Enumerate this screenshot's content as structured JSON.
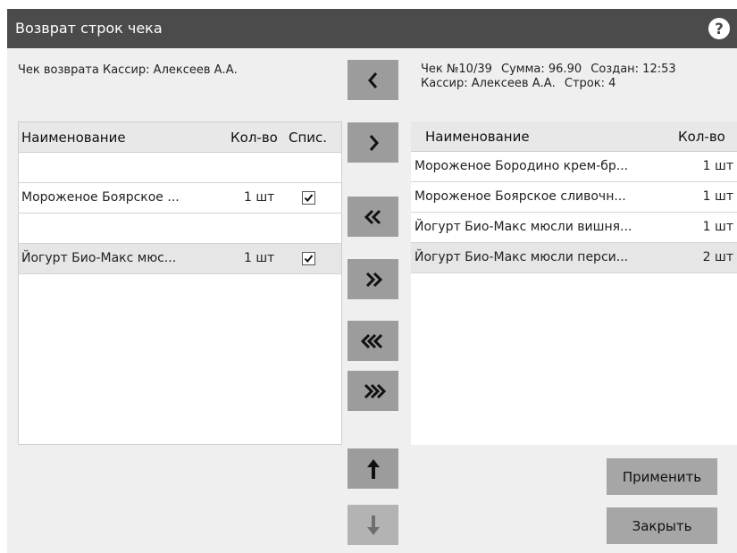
{
  "window": {
    "title": "Возврат строк чека",
    "help_icon": "question-icon"
  },
  "return_check": {
    "info": "Чек возврата  Кассир: Алексеев А.А.",
    "columns": {
      "name": "Наименование",
      "qty": "Кол-во",
      "writeoff": "Спис."
    },
    "rows": [
      {
        "name": "",
        "qty": "",
        "checked": false,
        "empty": true
      },
      {
        "name": "Мороженое Боярское ...",
        "qty": "1 шт",
        "checked": true,
        "empty": false
      },
      {
        "name": "",
        "qty": "",
        "checked": false,
        "empty": true
      },
      {
        "name": "Йогурт Био-Макс мюс...",
        "qty": "1 шт",
        "checked": true,
        "empty": false
      }
    ]
  },
  "source_check": {
    "info_line1": [
      "Чек №10/39",
      "Сумма: 96.90",
      "Создан: 12:53"
    ],
    "info_line2": [
      "Кассир: Алексеев А.А.",
      "Строк: 4"
    ],
    "columns": {
      "name": "Наименование",
      "qty": "Кол-во"
    },
    "rows": [
      {
        "name": "Мороженое Бородино крем-бр...",
        "qty": "1 шт"
      },
      {
        "name": "Мороженое Боярское сливочн...",
        "qty": "1 шт"
      },
      {
        "name": "Йогурт Био-Макс мюсли вишня...",
        "qty": "1 шт"
      },
      {
        "name": "Йогурт Био-Макс мюсли перси...",
        "qty": "2 шт"
      }
    ]
  },
  "nav_buttons": [
    {
      "name": "move-left-button",
      "icon": "chevron-left-icon",
      "glyph": "‹"
    },
    {
      "name": "move-right-button",
      "icon": "chevron-right-icon",
      "glyph": "›"
    },
    {
      "name": "move-left-double-button",
      "icon": "double-chevron-left-icon",
      "glyph": "«"
    },
    {
      "name": "move-right-double-button",
      "icon": "double-chevron-right-icon",
      "glyph": "»"
    },
    {
      "name": "move-all-left-button",
      "icon": "triple-chevron-left-icon",
      "glyph": "⋘"
    },
    {
      "name": "move-all-right-button",
      "icon": "triple-chevron-right-icon",
      "glyph": "⋙"
    },
    {
      "name": "move-up-button",
      "icon": "arrow-up-icon",
      "glyph": "↑"
    },
    {
      "name": "move-down-button",
      "icon": "arrow-down-icon",
      "glyph": "↓",
      "disabled": true
    }
  ],
  "actions": {
    "apply": "Применить",
    "close": "Закрыть"
  },
  "colors": {
    "titlebar": "#4b4b4b",
    "button": "#9c9c9c",
    "button_disabled": "#b3b3b3",
    "action": "#a6a6a6"
  }
}
